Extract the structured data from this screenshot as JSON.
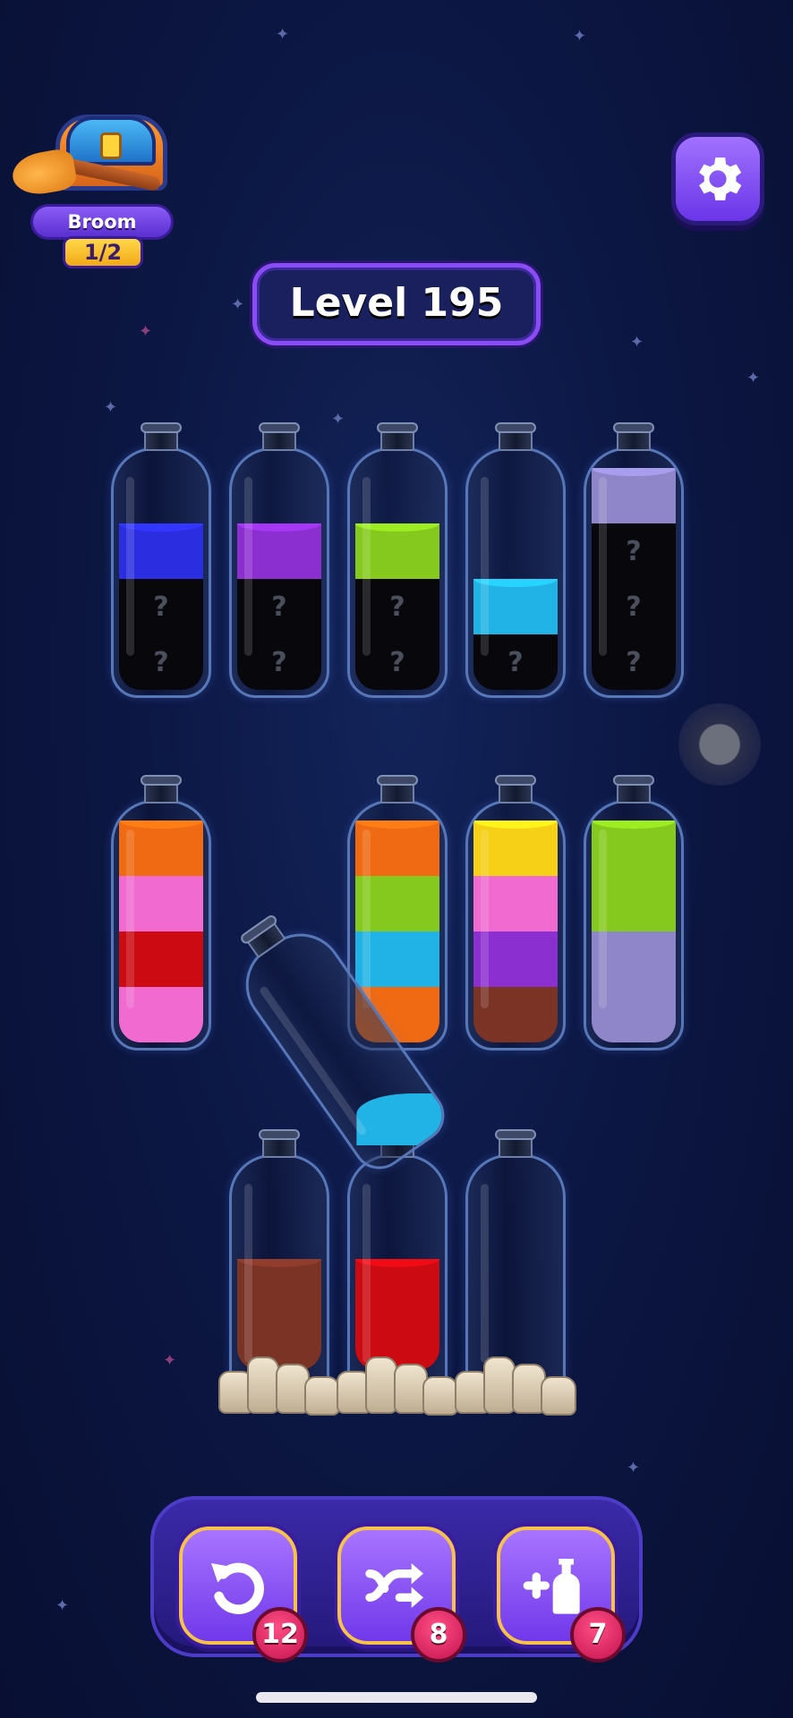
{
  "streak": {
    "title": "Broom Streak",
    "count": "1/2"
  },
  "level": {
    "label": "Level 195"
  },
  "settings": {
    "icon": "gear-icon"
  },
  "colors": {
    "blue": "#2b2ee0",
    "purple": "#8c2fd0",
    "lime": "#86c91e",
    "cyan": "#21b3e6",
    "lavender": "#8f86c9",
    "orange": "#ef6a12",
    "pink": "#f06ad0",
    "red": "#cc0a12",
    "yellow": "#f6cf17",
    "brown": "#7b3325",
    "hidden": "#08080c"
  },
  "bottles": [
    {
      "segments": [
        "blue",
        "hidden",
        "hidden"
      ]
    },
    {
      "segments": [
        "purple",
        "hidden",
        "hidden"
      ]
    },
    {
      "segments": [
        "lime",
        "hidden",
        "hidden"
      ]
    },
    {
      "segments": [
        "cyan",
        "hidden"
      ]
    },
    {
      "segments": [
        "lavender",
        "hidden",
        "hidden",
        "hidden"
      ]
    },
    {
      "segments": [
        "orange",
        "pink",
        "red",
        "pink"
      ]
    },
    {
      "segments": [
        "orange",
        "lime",
        "cyan",
        "orange"
      ]
    },
    {
      "segments": [
        "yellow",
        "pink",
        "purple",
        "brown"
      ]
    },
    {
      "segments": [
        "lime",
        "lime",
        "lavender",
        "lavender"
      ]
    },
    {
      "segments": [
        "brown",
        "brown"
      ]
    },
    {
      "segments": [
        "red",
        "red"
      ]
    },
    {
      "segments": []
    }
  ],
  "hidden_mark": "?",
  "powerups": [
    {
      "name": "undo",
      "icon": "undo-icon",
      "count": "12"
    },
    {
      "name": "shuffle",
      "icon": "shuffle-icon",
      "count": "8"
    },
    {
      "name": "add-bottle",
      "icon": "add-bottle-icon",
      "count": "7"
    }
  ]
}
